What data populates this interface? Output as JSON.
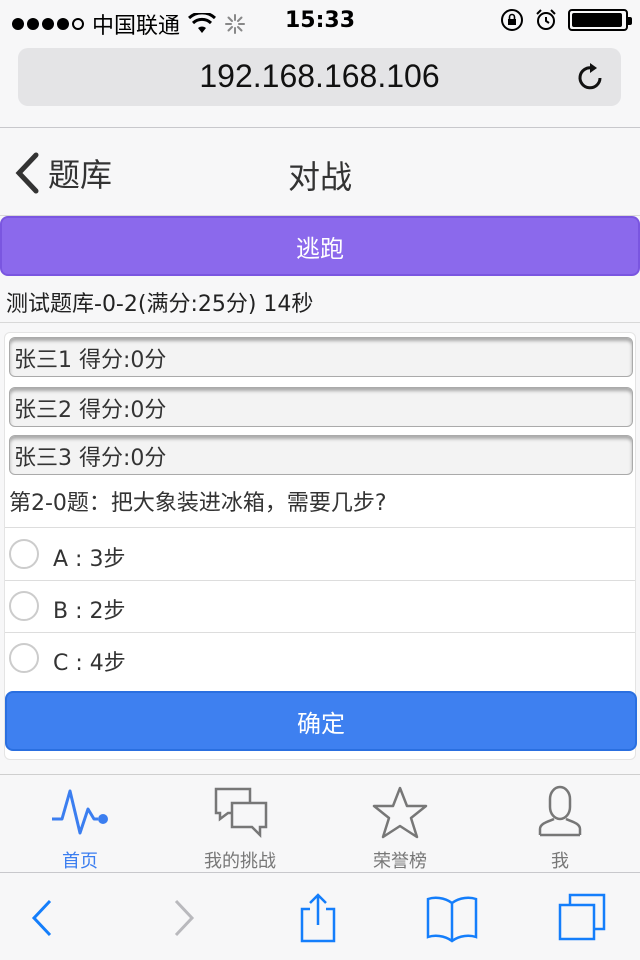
{
  "status_bar": {
    "carrier": "中国联通",
    "time": "15:33"
  },
  "browser": {
    "url": "192.168.168.106"
  },
  "nav": {
    "back_label": "题库",
    "title": "对战"
  },
  "battle": {
    "flee_label": "逃跑",
    "quiz_info": "测试题库-0-2(满分:25分) 14秒",
    "players": [
      "张三1 得分:0分",
      "张三2 得分:0分",
      "张三3 得分:0分"
    ],
    "question": "第2-0题：把大象装进冰箱，需要几步?",
    "options": [
      "A : 3步",
      "B : 2步",
      "C : 4步"
    ],
    "confirm_label": "确定"
  },
  "tabs": [
    {
      "label": "首页",
      "icon": "pulse-icon",
      "active": true
    },
    {
      "label": "我的挑战",
      "icon": "chat-bubbles-icon",
      "active": false
    },
    {
      "label": "荣誉榜",
      "icon": "star-icon",
      "active": false
    },
    {
      "label": "我",
      "icon": "user-icon",
      "active": false
    }
  ],
  "colors": {
    "flee": "#8b69ec",
    "confirm": "#3e80f0",
    "active_tab": "#3b7ef0",
    "safari_tint": "#147efb"
  }
}
